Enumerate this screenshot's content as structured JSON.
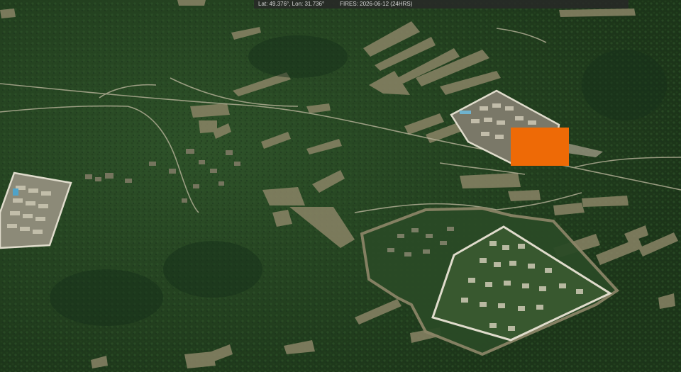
{
  "status_bar": {
    "lat_text": "Lat: 49.376°, Lon: 31.736°",
    "fires_text": "FIRES: 2026-06-12 (24HRS)"
  },
  "fire_marker": {
    "color": "#ee6a06",
    "label": ""
  },
  "colors": {
    "forest_dark": "#1f3a1c",
    "forest_mid": "#2a4a25",
    "clearing": "#8a8466",
    "road": "#b8b39a",
    "compound_wall": "#e0dccc"
  }
}
